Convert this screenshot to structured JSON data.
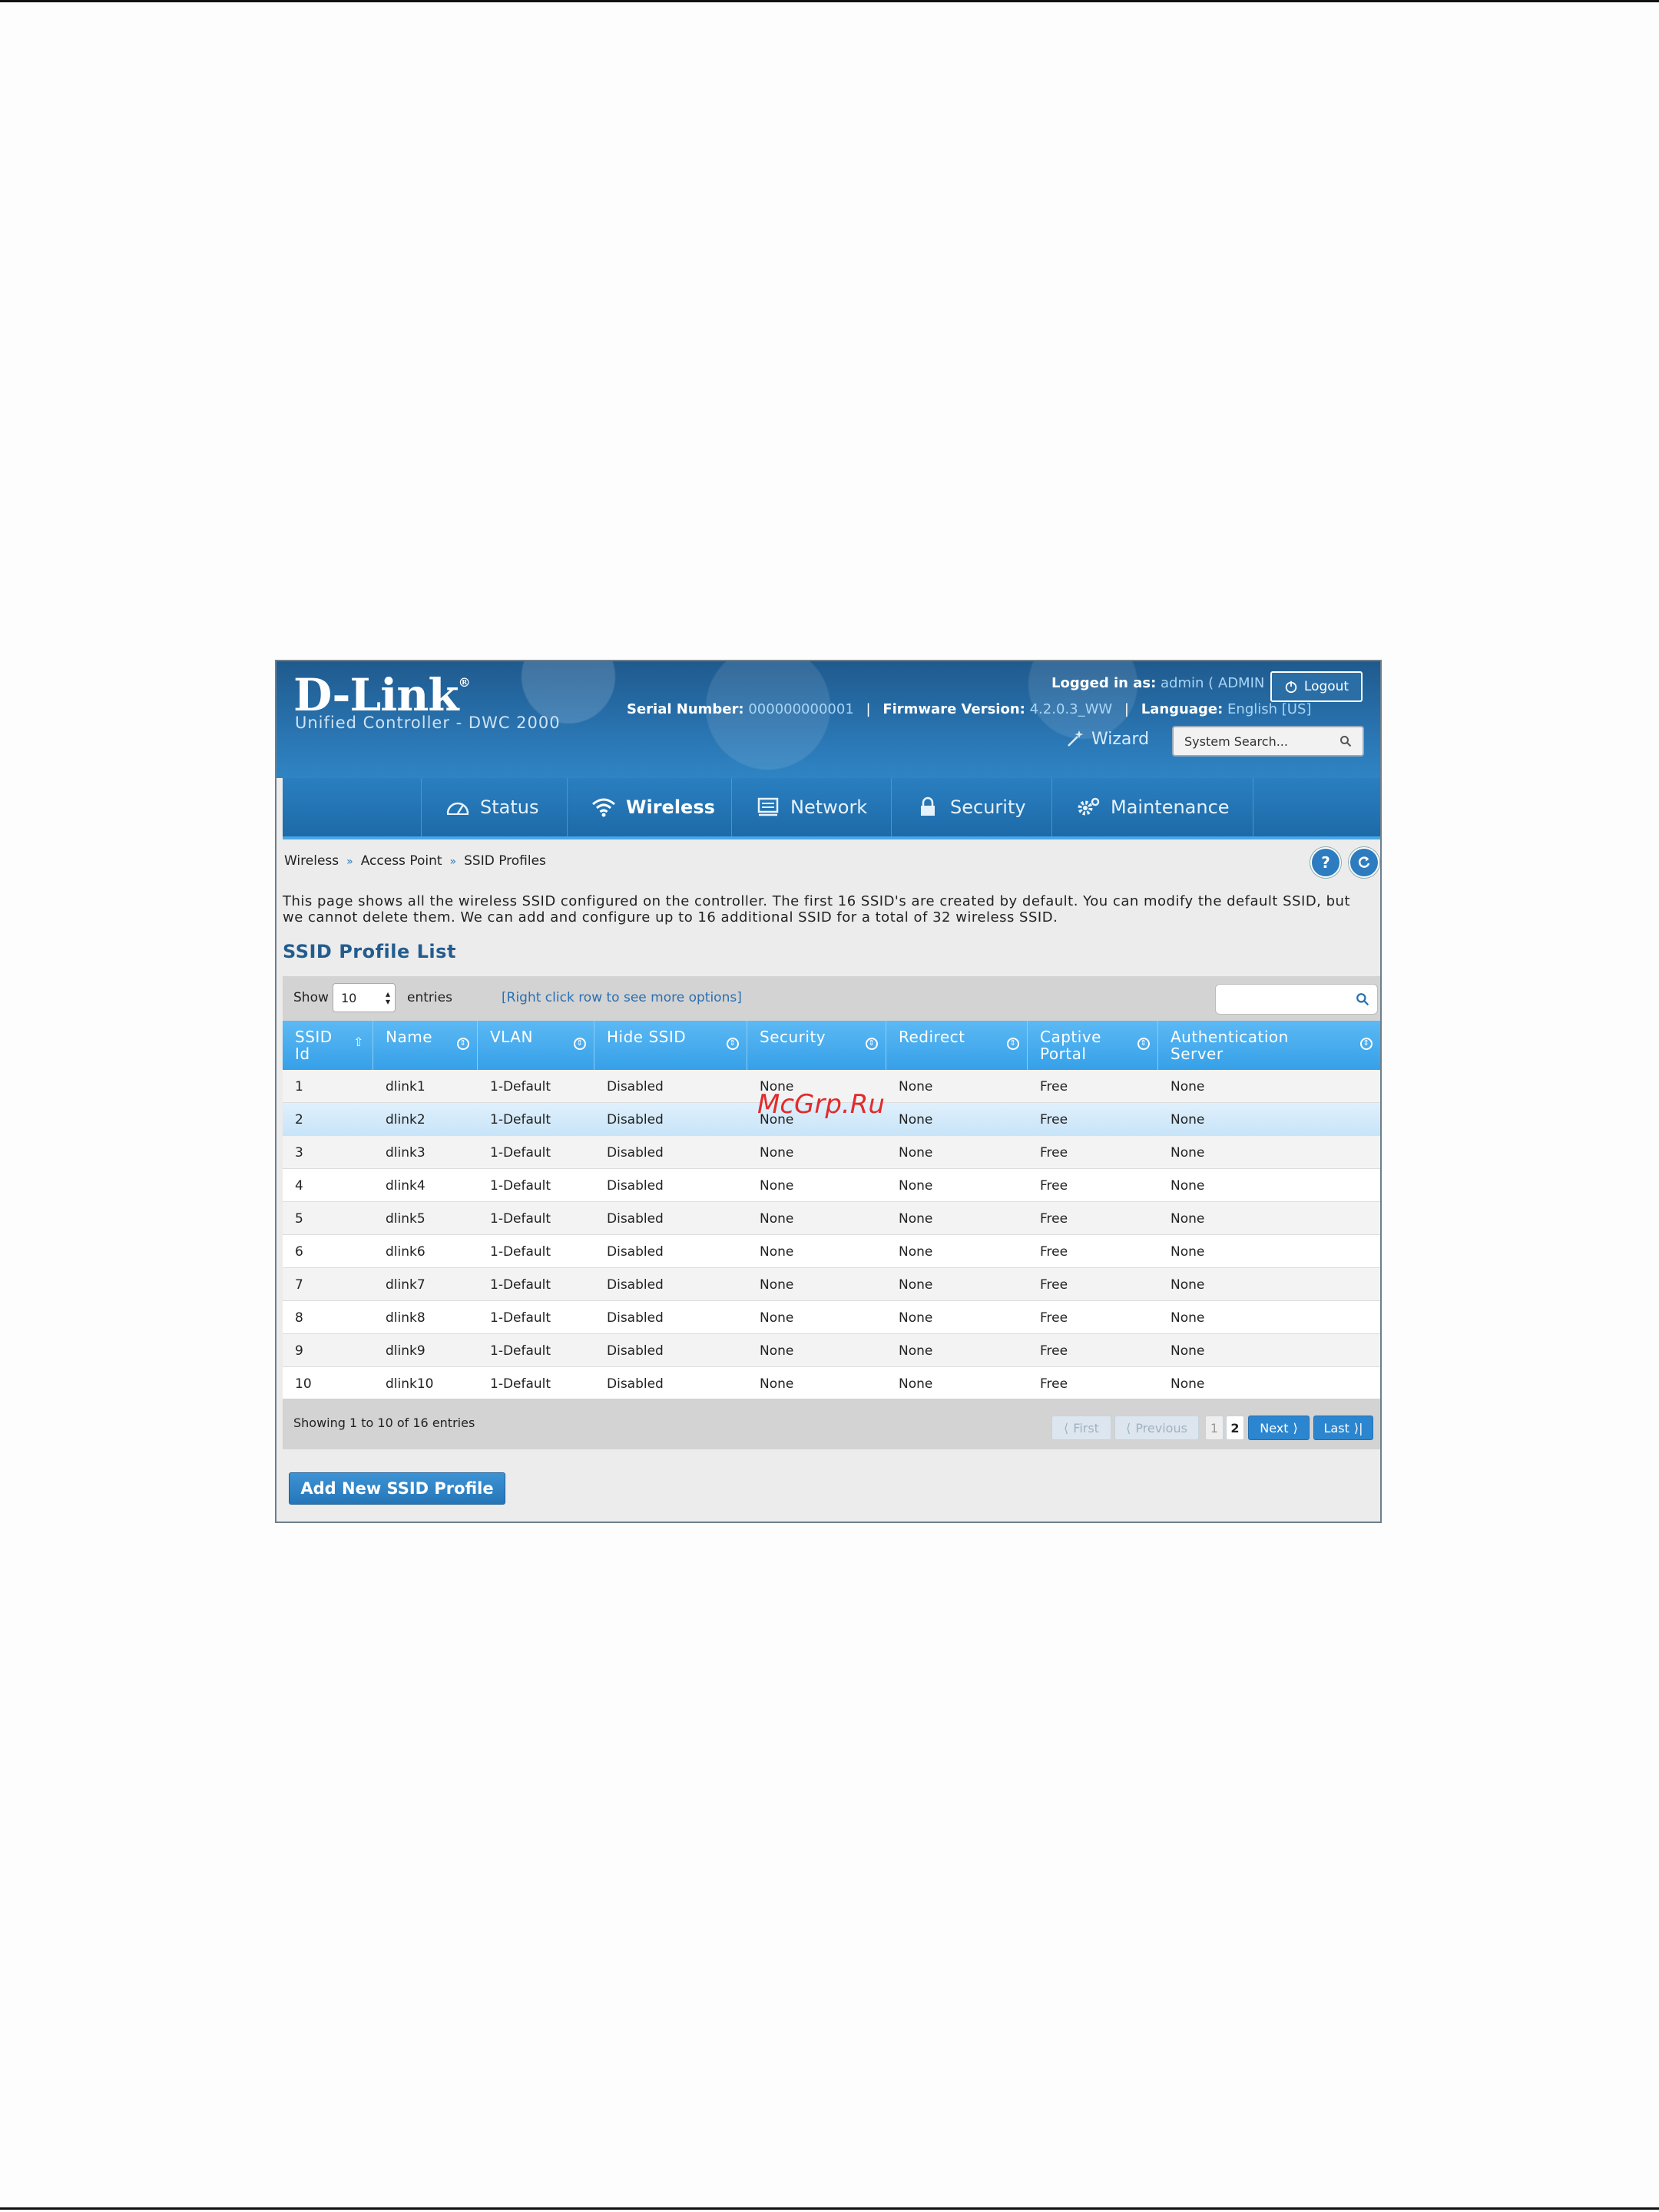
{
  "brand": {
    "logo": "D-Link",
    "subtitle": "Unified Controller - DWC 2000"
  },
  "header": {
    "logged_in_label": "Logged in as:",
    "logged_in_value": "admin ( ADMIN )",
    "logout_label": "Logout",
    "serial_label": "Serial Number:",
    "serial_value": "000000000001",
    "firmware_label": "Firmware Version:",
    "firmware_value": "4.2.0.3_WW",
    "language_label": "Language:",
    "language_value": "English [US]",
    "wizard_label": "Wizard",
    "search_placeholder": "System Search..."
  },
  "nav": [
    {
      "label": "Status",
      "icon": "gauge-icon"
    },
    {
      "label": "Wireless",
      "icon": "wifi-icon",
      "active": true
    },
    {
      "label": "Network",
      "icon": "monitor-icon"
    },
    {
      "label": "Security",
      "icon": "lock-icon"
    },
    {
      "label": "Maintenance",
      "icon": "gears-icon"
    }
  ],
  "breadcrumb": [
    "Wireless",
    "Access Point",
    "SSID Profiles"
  ],
  "description": "This page shows all the wireless SSID configured on the controller. The first 16 SSID's are created by default. You can modify the default SSID, but we cannot delete them. We can add and configure up to 16 additional SSID for a total of 32 wireless SSID.",
  "section_title": "SSID Profile List",
  "toolbar": {
    "show_label": "Show",
    "entries_value": "10",
    "entries_label": "entries",
    "hint": "[Right click row to see more options]"
  },
  "table": {
    "columns": [
      [
        "SSID",
        "Id"
      ],
      [
        "Name",
        ""
      ],
      [
        "VLAN",
        ""
      ],
      [
        "Hide SSID",
        ""
      ],
      [
        "Security",
        ""
      ],
      [
        "Redirect",
        ""
      ],
      [
        "Captive",
        "Portal"
      ],
      [
        "Authentication",
        "Server"
      ]
    ],
    "rows": [
      [
        "1",
        "dlink1",
        "1-Default",
        "Disabled",
        "None",
        "None",
        "Free",
        "None"
      ],
      [
        "2",
        "dlink2",
        "1-Default",
        "Disabled",
        "None",
        "None",
        "Free",
        "None"
      ],
      [
        "3",
        "dlink3",
        "1-Default",
        "Disabled",
        "None",
        "None",
        "Free",
        "None"
      ],
      [
        "4",
        "dlink4",
        "1-Default",
        "Disabled",
        "None",
        "None",
        "Free",
        "None"
      ],
      [
        "5",
        "dlink5",
        "1-Default",
        "Disabled",
        "None",
        "None",
        "Free",
        "None"
      ],
      [
        "6",
        "dlink6",
        "1-Default",
        "Disabled",
        "None",
        "None",
        "Free",
        "None"
      ],
      [
        "7",
        "dlink7",
        "1-Default",
        "Disabled",
        "None",
        "None",
        "Free",
        "None"
      ],
      [
        "8",
        "dlink8",
        "1-Default",
        "Disabled",
        "None",
        "None",
        "Free",
        "None"
      ],
      [
        "9",
        "dlink9",
        "1-Default",
        "Disabled",
        "None",
        "None",
        "Free",
        "None"
      ],
      [
        "10",
        "dlink10",
        "1-Default",
        "Disabled",
        "None",
        "None",
        "Free",
        "None"
      ]
    ]
  },
  "footer": {
    "info": "Showing 1 to 10 of 16 entries",
    "first": "First",
    "previous": "Previous",
    "page1": "1",
    "page2": "2",
    "next": "Next",
    "last": "Last"
  },
  "add_button": "Add New SSID Profile",
  "watermark": "McGrp.Ru",
  "colors": {
    "header_blue": "#2b78b6",
    "table_header": "#36a0e8",
    "link_blue": "#2a6fb0"
  }
}
